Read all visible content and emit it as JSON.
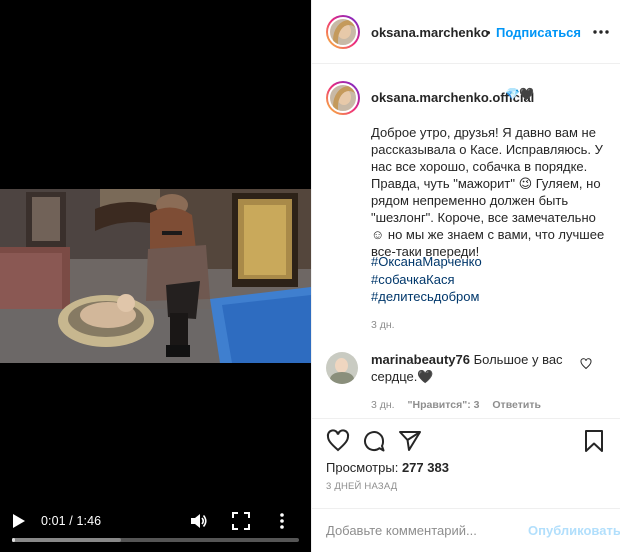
{
  "video": {
    "current_time": "0:01",
    "separator": " / ",
    "duration": "1:46",
    "progress_fraction": 0.0094,
    "buffered_fraction": 0.38,
    "icons": [
      "play-icon",
      "volume-icon",
      "fullscreen-icon",
      "more-vertical-icon"
    ]
  },
  "header": {
    "username": "oksana.marchenko",
    "dot": "•",
    "follow_label": "Подписаться",
    "options_icon": "more-horizontal-icon"
  },
  "caption": {
    "username": "oksana.marchenko.official",
    "badge": "💎🖤",
    "text": "Доброе утро, друзья! Я давно вам не рассказывала о Касе. Исправляюсь. У нас все хорошо, собачка в порядке. Правда, чуть \"мажорит\" 😉 Гуляем, но рядом непременно должен быть \"шезлонг\". Короче, все замечательно ☺ но мы же знаем с вами, что лучшее все-таки впереди!",
    "hashtags": [
      "#ОксанаМарченко",
      "#собачкаКася",
      "#делитесьдобром"
    ],
    "time": "3 дн."
  },
  "comment": {
    "username": "marinabeauty76",
    "text": "Большое у вас сердце.🖤",
    "time": "3 дн.",
    "likes": "\"Нравится\": 3",
    "reply": "Ответить"
  },
  "actions": {
    "icons": [
      "heart-icon",
      "comment-icon",
      "share-icon",
      "bookmark-icon"
    ],
    "views_label": "Просмотры:",
    "views_count": "277 383",
    "date": "3 ДНЕЙ НАЗАД"
  },
  "composer": {
    "placeholder": "Добавьте комментарий...",
    "publish_label": "Опубликовать"
  },
  "colors": {
    "link": "#0095f6",
    "hashtag": "#00376b",
    "muted": "#8e8e8e",
    "publish_disabled": "#b2dffc",
    "video_bg": "#000000"
  }
}
